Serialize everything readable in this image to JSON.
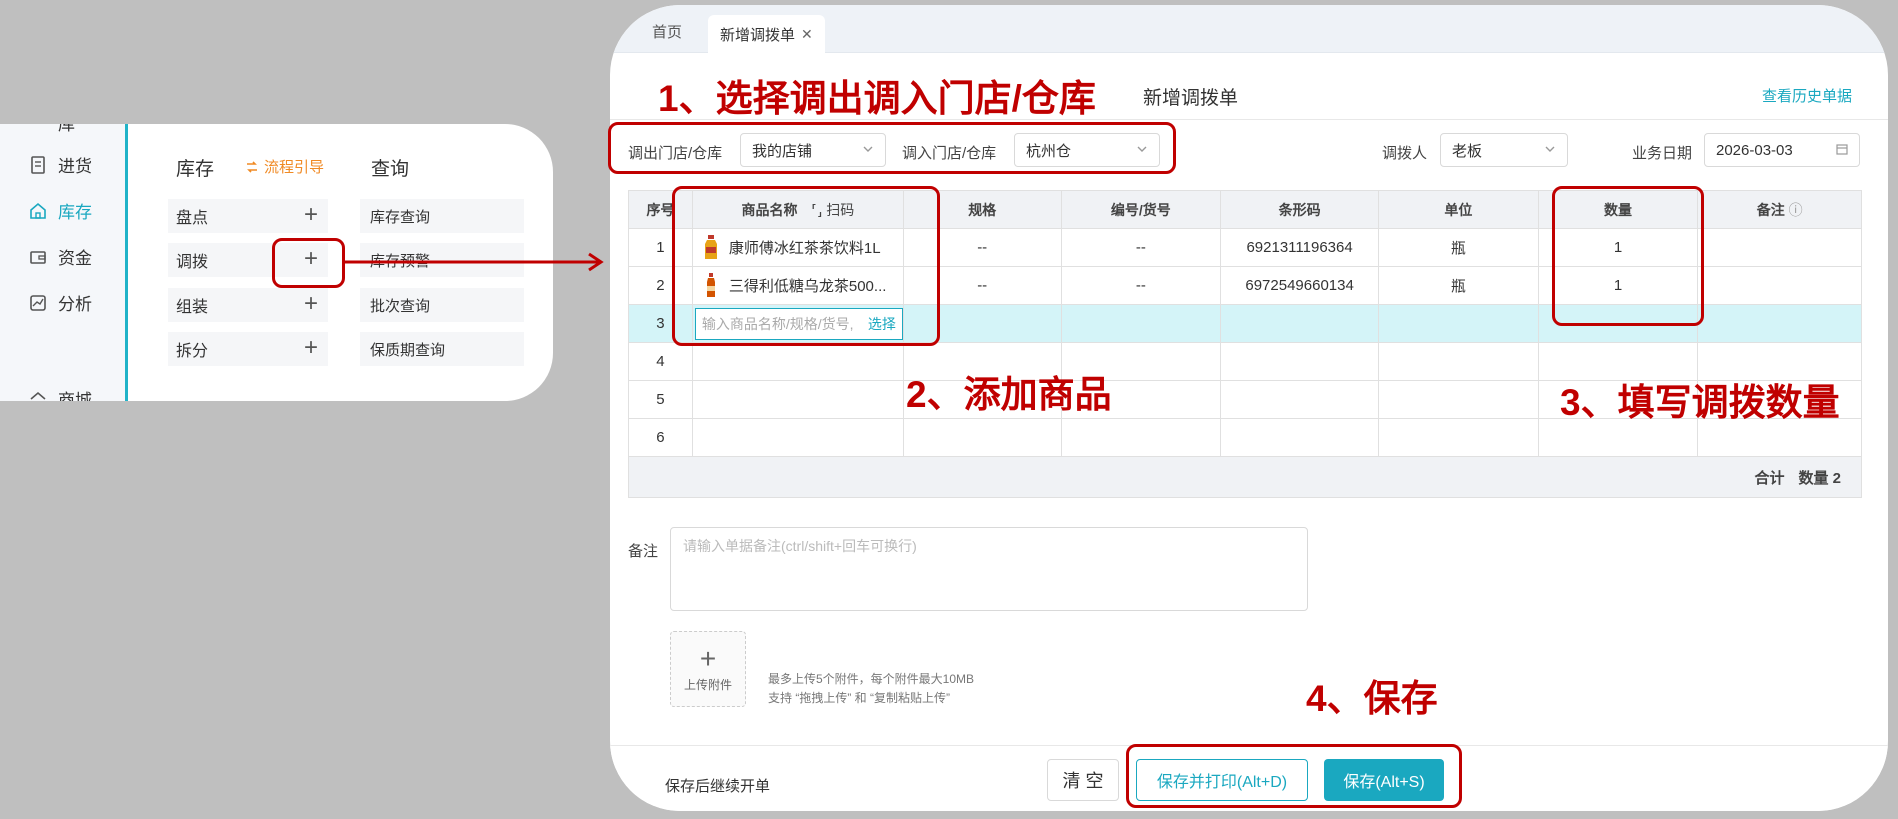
{
  "menu": {
    "items": [
      {
        "label": "进货",
        "icon": "receipt-icon"
      },
      {
        "label": "库存",
        "icon": "home-icon"
      },
      {
        "label": "资金",
        "icon": "wallet-icon"
      },
      {
        "label": "分析",
        "icon": "chart-icon"
      },
      {
        "label": "商城",
        "icon": "store-icon"
      }
    ],
    "inventory_title": "库存",
    "flow_guide": "流程引导",
    "query_title": "查询",
    "ops": [
      "盘点",
      "调拨",
      "组装",
      "拆分"
    ],
    "queries": [
      "库存查询",
      "库存预警",
      "批次查询",
      "保质期查询"
    ]
  },
  "tabs": {
    "home": "首页",
    "active": "新增调拨单"
  },
  "page_title": "新增调拨单",
  "history_link": "查看历史单据",
  "form": {
    "out_label": "调出门店/仓库",
    "out_value": "我的店铺",
    "in_label": "调入门店/仓库",
    "in_value": "杭州仓",
    "operator_label": "调拨人",
    "operator_value": "老板",
    "date_label": "业务日期",
    "date_value": "2026-03-03"
  },
  "table": {
    "headers": [
      "序号",
      "商品名称",
      "扫码",
      "规格",
      "编号/货号",
      "条形码",
      "单位",
      "数量",
      "备注"
    ],
    "rows": [
      {
        "no": "1",
        "name": "康师傅冰红茶茶饮料1L",
        "spec": "--",
        "code": "--",
        "barcode": "6921311196364",
        "unit": "瓶",
        "qty": "1"
      },
      {
        "no": "2",
        "name": "三得利低糖乌龙茶500...",
        "spec": "--",
        "code": "--",
        "barcode": "6972549660134",
        "unit": "瓶",
        "qty": "1"
      }
    ],
    "input_row_no": "3",
    "input_placeholder": "输入商品名称/规格/货号,",
    "input_pick": "选择",
    "empty_rows": [
      "4",
      "5",
      "6"
    ],
    "total_label": "合计",
    "total_qty": "数量 2"
  },
  "remark": {
    "label": "备注",
    "placeholder": "请输入单据备注(ctrl/shift+回车可换行)"
  },
  "upload": {
    "plus": "+",
    "label": "上传附件",
    "hint1": "最多上传5个附件，每个附件最大10MB",
    "hint2": "支持 “拖拽上传” 和 “复制粘贴上传”"
  },
  "footer": {
    "continue_label": "保存后继续开单",
    "clear": "清 空",
    "save_print": "保存并打印(Alt+D)",
    "save": "保存(Alt+S)"
  },
  "annotations": {
    "step1": "1、选择调出调入门店/仓库",
    "step2": "2、添加商品",
    "step3": "3、填写调拨数量",
    "step4": "4、保存"
  },
  "colors": {
    "accent": "#1aa8c0",
    "annotation": "#c00000",
    "orange": "#f08a24"
  }
}
